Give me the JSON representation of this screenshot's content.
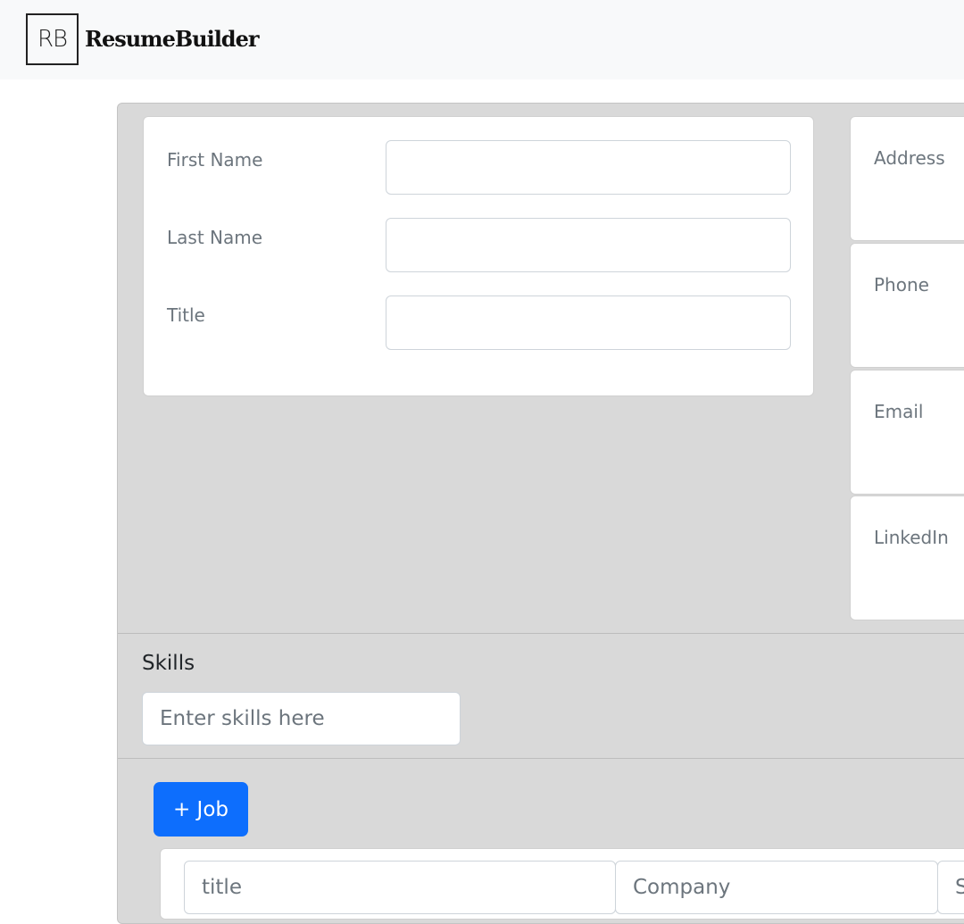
{
  "navbar": {
    "logo_text": "RB",
    "brand": "ResumeBuilder"
  },
  "name_panel": {
    "first_name_label": "First Name",
    "last_name_label": "Last Name",
    "title_label": "Title"
  },
  "contact": {
    "address_label": "Address",
    "phone_label": "Phone",
    "email_label": "Email",
    "linkedin_label": "LinkedIn"
  },
  "skills": {
    "heading": "Skills",
    "placeholder": "Enter skills here"
  },
  "jobs": {
    "add_button": "+ Job",
    "title_placeholder": "title",
    "company_placeholder": "Company",
    "third_placeholder": "S"
  }
}
